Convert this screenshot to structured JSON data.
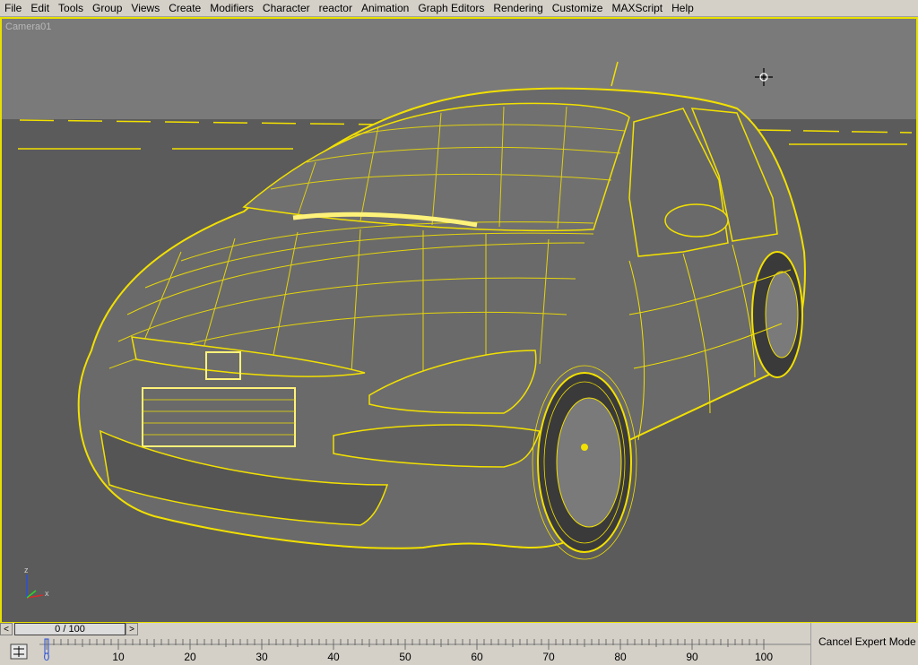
{
  "menu": [
    "File",
    "Edit",
    "Tools",
    "Group",
    "Views",
    "Create",
    "Modifiers",
    "Character",
    "reactor",
    "Animation",
    "Graph Editors",
    "Rendering",
    "Customize",
    "MAXScript",
    "Help"
  ],
  "viewport": {
    "label": "Camera01"
  },
  "axis_gizmo": {
    "z": "z",
    "x": "x"
  },
  "time_slider": {
    "prev": "<",
    "next": ">",
    "position_text": "0 / 100",
    "current_frame": 0,
    "total_frames": 100
  },
  "trackbar": {
    "ticks": [
      "0",
      "10",
      "20",
      "30",
      "40",
      "50",
      "60",
      "70",
      "80",
      "90",
      "100"
    ]
  },
  "status": {
    "expert_mode_label": "Cancel Expert Mode"
  },
  "colors": {
    "wire": "#f2e000",
    "viewport_bg": "#5a5a5a",
    "sky": "#7a7a7a",
    "ui_gray": "#d4d0c8"
  }
}
